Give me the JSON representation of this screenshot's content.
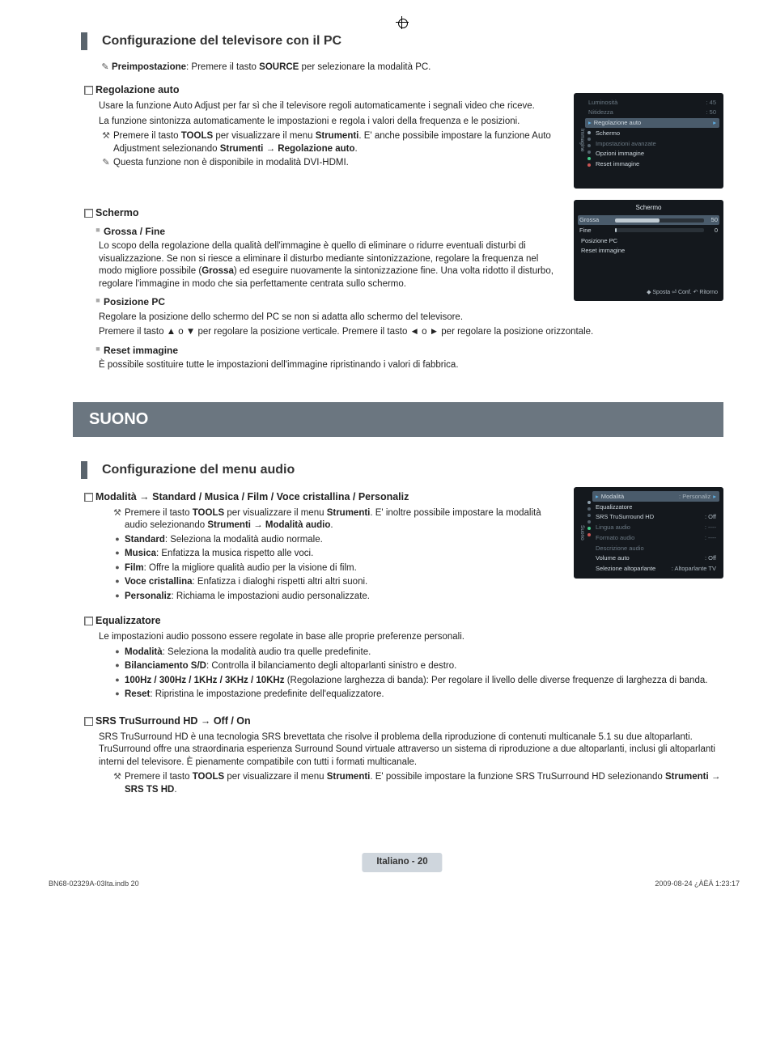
{
  "header": {
    "section1": "Configurazione del televisore con il PC"
  },
  "preimp": {
    "prefix": "Preimpostazione",
    "rest": ": Premere il tasto ",
    "source": "SOURCE",
    "rest2": " per selezionare la modalità PC."
  },
  "reg_auto": {
    "title": "Regolazione auto",
    "p1": "Usare la funzione Auto Adjust per far sì che il televisore regoli automaticamente i segnali video che riceve.",
    "p2": "La funzione sintonizza automaticamente le impostazioni e regola i valori della frequenza e le posizioni.",
    "tool_a": "Premere il tasto ",
    "tool_b": "TOOLS",
    "tool_c": " per visualizzare il menu ",
    "tool_d": "Strumenti",
    "tool_e": ". E' anche possibile impostare la funzione Auto Adjustment selezionando ",
    "tool_f": "Strumenti → Regolazione auto",
    "tool_g": ".",
    "note": "Questa funzione non è disponibile in modalità DVI-HDMI."
  },
  "schermo": {
    "title": "Schermo",
    "gf_title": "Grossa / Fine",
    "gf_body": "Lo scopo della regolazione della qualità dell'immagine è quello di eliminare o ridurre eventuali disturbi di visualizzazione. Se non si riesce a eliminare il disturbo mediante sintonizzazione, regolare la frequenza nel modo migliore possibile (",
    "gf_bold": "Grossa",
    "gf_body2": ") ed eseguire nuovamente la sintonizzazione fine. Una volta ridotto il disturbo, regolare l'immagine in modo che sia perfettamente centrata sullo schermo.",
    "pos_title": "Posizione PC",
    "pos_p1": "Regolare la posizione dello schermo del PC se non si adatta allo schermo del televisore.",
    "pos_p2": "Premere il tasto ▲ o ▼ per regolare la posizione verticale. Premere il tasto ◄ o ► per regolare la posizione orizzontale.",
    "reset_title": "Reset immagine",
    "reset_body": "È possibile sostituire tutte le impostazioni dell'immagine ripristinando i valori di fabbrica."
  },
  "band": "SUONO",
  "audio_head": "Configurazione del menu audio",
  "modalita": {
    "title": "Modalità → Standard / Musica / Film / Voce cristallina / Personaliz",
    "tool_a": "Premere il tasto ",
    "tool_b": "TOOLS",
    "tool_c": " per visualizzare il menu ",
    "tool_d": "Strumenti",
    "tool_e": ". E' inoltre possibile impostare la modalità audio selezionando ",
    "tool_f": "Strumenti → Modalità audio",
    "tool_g": ".",
    "items": [
      {
        "b": "Standard",
        "t": ": Seleziona la modalità audio normale."
      },
      {
        "b": "Musica",
        "t": ": Enfatizza la musica rispetto alle voci."
      },
      {
        "b": "Film",
        "t": ": Offre la migliore qualità audio per la visione di film."
      },
      {
        "b": "Voce cristallina",
        "t": ": Enfatizza i dialoghi rispetti altri altri suoni."
      },
      {
        "b": "Personaliz",
        "t": ": Richiama le impostazioni audio personalizzate."
      }
    ]
  },
  "eq": {
    "title": "Equalizzatore",
    "intro": "Le impostazioni audio possono essere regolate in base alle proprie preferenze personali.",
    "items": [
      {
        "b": "Modalità",
        "t": ": Seleziona la modalità audio tra quelle predefinite."
      },
      {
        "b": "Bilanciamento S/D",
        "t": ": Controlla il bilanciamento degli altoparlanti sinistro e destro."
      },
      {
        "b": "100Hz / 300Hz / 1KHz / 3KHz / 10KHz",
        "t": " (Regolazione larghezza di banda): Per regolare il livello delle diverse frequenze di larghezza di banda."
      },
      {
        "b": "Reset",
        "t": ": Ripristina le impostazione predefinite dell'equalizzatore."
      }
    ]
  },
  "srs": {
    "title": "SRS TruSurround HD → Off / On",
    "body": "SRS TruSurround HD è una tecnologia SRS brevettata che risolve il problema della riproduzione di contenuti multicanale 5.1 su due altoparlanti. TruSurround offre una straordinaria esperienza Surround Sound virtuale attraverso un sistema di riproduzione a due altoparlanti, inclusi gli altoparlanti interni del televisore. È pienamente compatibile con tutti i formati multicanale.",
    "tool_a": "Premere il tasto ",
    "tool_b": "TOOLS",
    "tool_c": " per visualizzare il menu ",
    "tool_d": "Strumenti",
    "tool_e": ". E' possibile impostare la funzione SRS TruSurround HD selezionando ",
    "tool_f": "Strumenti → SRS TS HD",
    "tool_g": "."
  },
  "osd1": {
    "strip": "Immagine",
    "rows": [
      {
        "label": "Luminosità",
        "val": ": 45",
        "dim": true,
        "bar": 45
      },
      {
        "label": "Nitidezza",
        "val": ": 50",
        "dim": true,
        "bar": 50
      }
    ],
    "hl": "Regolazione auto",
    "list": [
      "Schermo",
      "Impostazioni avanzate",
      "Opzioni immagine",
      "Reset immagine"
    ]
  },
  "osd2": {
    "title": "Schermo",
    "rows": [
      {
        "label": "Grossa",
        "val": "50",
        "hl": true,
        "fill": 50
      },
      {
        "label": "Fine",
        "val": "0",
        "fill": 0
      }
    ],
    "list": [
      "Posizione PC",
      "Reset immagine"
    ],
    "foot": "◆ Sposta   ⏎ Conf.   ↶ Ritorno"
  },
  "osd3": {
    "strip": "Suono",
    "hl_label": "Modalità",
    "hl_val": ": Personaliz",
    "rows": [
      {
        "label": "Equalizzatore",
        "val": ""
      },
      {
        "label": "SRS TruSurround HD",
        "val": ": Off"
      },
      {
        "label": "Lingua audio",
        "val": ": ----",
        "dim": true
      },
      {
        "label": "Formato audio",
        "val": ": ----",
        "dim": true
      },
      {
        "label": "Descrizione audio",
        "val": "",
        "dim": true
      },
      {
        "label": "Volume auto",
        "val": ": Off"
      },
      {
        "label": "Selezione altoparlante",
        "val": ": Altoparlante TV"
      }
    ]
  },
  "footer": {
    "pill": "Italiano - 20",
    "left": "BN68-02329A-03Ita.indb   20",
    "right": "2009-08-24   ¿ÀÈÄ 1:23:17"
  }
}
